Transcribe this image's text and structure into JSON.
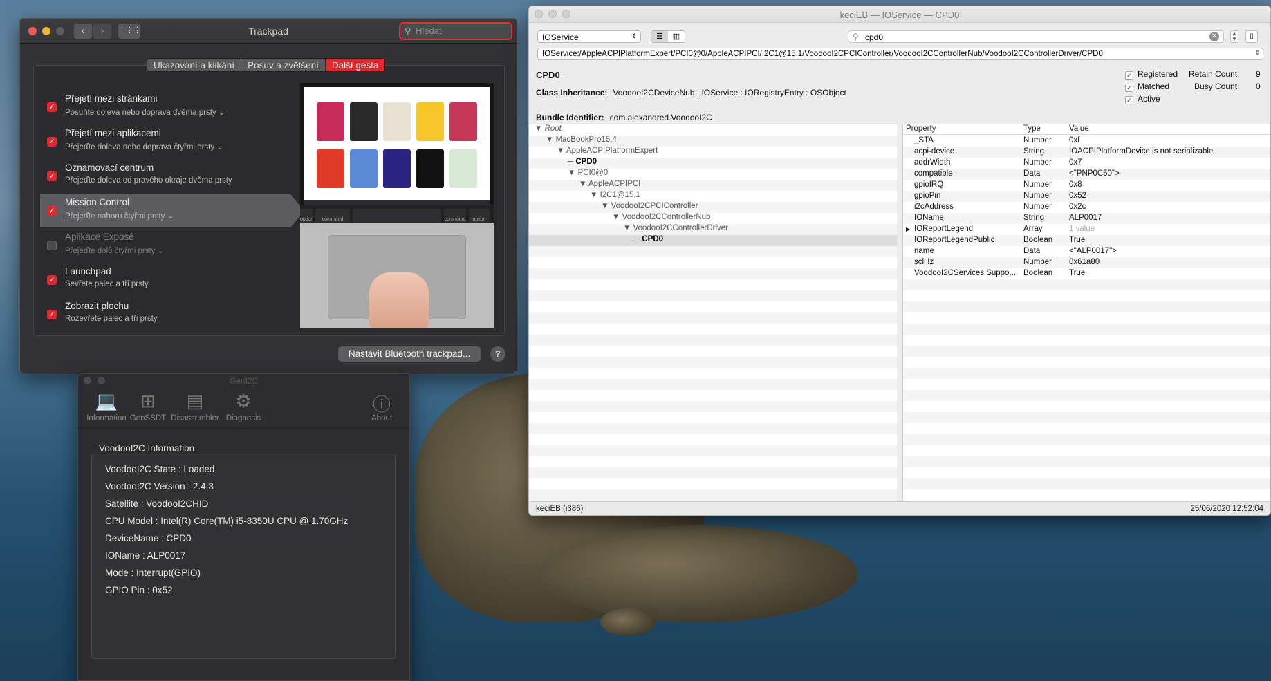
{
  "trackpad": {
    "title": "Trackpad",
    "search_placeholder": "Hledat",
    "tabs": [
      "Ukazování a klikání",
      "Posuv a zvětšení",
      "Další gesta"
    ],
    "active_tab_index": 2,
    "gestures": [
      {
        "title": "Přejetí mezi stránkami",
        "subtitle": "Posuňte doleva nebo doprava dvěma prsty",
        "checked": true,
        "dropdown": true
      },
      {
        "title": "Přejetí mezi aplikacemi",
        "subtitle": "Přejeďte doleva nebo doprava čtyřmi prsty",
        "checked": true,
        "dropdown": true
      },
      {
        "title": "Oznamovací centrum",
        "subtitle": "Přejeďte doleva od pravého okraje dvěma prsty",
        "checked": true,
        "dropdown": false
      },
      {
        "title": "Mission Control",
        "subtitle": "Přejeďte nahoru čtyřmi prsty",
        "checked": true,
        "dropdown": true,
        "selected": true
      },
      {
        "title": "Aplikace Exposé",
        "subtitle": "Přejeďte dolů čtyřmi prsty",
        "checked": false,
        "dropdown": true
      },
      {
        "title": "Launchpad",
        "subtitle": "Sevřete palec a tři prsty",
        "checked": true,
        "dropdown": false
      },
      {
        "title": "Zobrazit plochu",
        "subtitle": "Rozevřete palec a tři prsty",
        "checked": true,
        "dropdown": false
      }
    ],
    "bluetooth_button": "Nastavit Bluetooth trackpad...",
    "help_button": "?",
    "preview_keys": [
      "option",
      "command",
      "command",
      "option"
    ]
  },
  "geni2c": {
    "title": "GenI2C",
    "toolbar": [
      "Information",
      "GenSSDT",
      "Disassembler",
      "Diagnosis",
      "About"
    ],
    "group_title": "VoodooI2C Information",
    "info_lines": [
      "VoodooI2C State : Loaded",
      "VoodooI2C Version : 2.4.3",
      "Satellite : VoodooI2CHID",
      "CPU Model : Intel(R) Core(TM) i5-8350U CPU @ 1.70GHz",
      "DeviceName : CPD0",
      "IOName : ALP0017",
      "Mode : Interrupt(GPIO)",
      "GPIO Pin : 0x52"
    ]
  },
  "ioreg": {
    "title": "keciEB — IOService — CPD0",
    "plane": "IOService",
    "search_value": "cpd0",
    "path": "IOService:/AppleACPIPlatformExpert/PCI0@0/AppleACPIPCI/I2C1@15,1/VoodooI2CPCIController/VoodooI2CControllerNub/VoodooI2CControllerDriver/CPD0",
    "class_name": "CPD0",
    "class_inheritance_label": "Class Inheritance:",
    "class_inheritance": "VoodooI2CDeviceNub : IOService : IORegistryEntry : OSObject",
    "bundle_label": "Bundle Identifier:",
    "bundle_id": "com.alexandred.VoodooI2C",
    "flags": [
      {
        "label": "Registered",
        "checked": true
      },
      {
        "label": "Matched",
        "checked": true
      },
      {
        "label": "Active",
        "checked": true
      }
    ],
    "retain_label": "Retain Count:",
    "retain_count": "9",
    "busy_label": "Busy Count:",
    "busy_count": "0",
    "tree": [
      {
        "label": "Root",
        "depth": 0,
        "italic": true
      },
      {
        "label": "MacBookPro15,4",
        "depth": 1
      },
      {
        "label": "AppleACPIPlatformExpert",
        "depth": 2
      },
      {
        "label": "CPD0",
        "depth": 3,
        "bold": true
      },
      {
        "label": "PCI0@0",
        "depth": 3
      },
      {
        "label": "AppleACPIPCI",
        "depth": 4
      },
      {
        "label": "I2C1@15,1",
        "depth": 5
      },
      {
        "label": "VoodooI2CPCIController",
        "depth": 6
      },
      {
        "label": "VoodooI2CControllerNub",
        "depth": 7
      },
      {
        "label": "VoodooI2CControllerDriver",
        "depth": 8
      },
      {
        "label": "CPD0",
        "depth": 9,
        "bold": true,
        "selected": true
      }
    ],
    "columns": [
      "Property",
      "Type",
      "Value"
    ],
    "properties": [
      {
        "p": "_STA",
        "t": "Number",
        "v": "0xf"
      },
      {
        "p": "acpi-device",
        "t": "String",
        "v": "IOACPIPlatformDevice is not serializable"
      },
      {
        "p": "addrWidth",
        "t": "Number",
        "v": "0x7"
      },
      {
        "p": "compatible",
        "t": "Data",
        "v": "<\"PNP0C50\">"
      },
      {
        "p": "gpioIRQ",
        "t": "Number",
        "v": "0x8"
      },
      {
        "p": "gpioPin",
        "t": "Number",
        "v": "0x52"
      },
      {
        "p": "i2cAddress",
        "t": "Number",
        "v": "0x2c"
      },
      {
        "p": "IOName",
        "t": "String",
        "v": "ALP0017"
      },
      {
        "p": "IOReportLegend",
        "t": "Array",
        "v": "1 value",
        "expandable": true,
        "muted": true
      },
      {
        "p": "IOReportLegendPublic",
        "t": "Boolean",
        "v": "True"
      },
      {
        "p": "name",
        "t": "Data",
        "v": "<\"ALP0017\">"
      },
      {
        "p": "sclHz",
        "t": "Number",
        "v": "0x61a80"
      },
      {
        "p": "VoodooI2CServices Suppo...",
        "t": "Boolean",
        "v": "True"
      }
    ],
    "status_left": "keciEB (i386)",
    "status_right": "25/06/2020 12:52:04"
  }
}
